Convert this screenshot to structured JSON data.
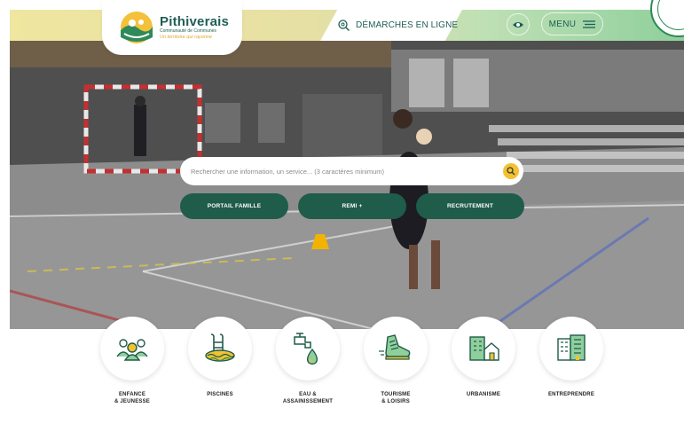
{
  "header": {
    "logo": {
      "name": "Pithiverais",
      "subtitle": "Communauté de Communes",
      "tagline": "Un territoire qui rayonne"
    },
    "demarches_label": "DÉMARCHES EN LIGNE",
    "menu_label": "MENU"
  },
  "search": {
    "placeholder": "Rechercher une information, un service... (3 caractères minimum)"
  },
  "quick_links": [
    {
      "label": "PORTAIL FAMILLE"
    },
    {
      "label": "REMI +"
    },
    {
      "label": "RECRUTEMENT"
    }
  ],
  "categories": [
    {
      "line1": "ENFANCE",
      "line2": "& JEUNESSE",
      "icon": "children-icon"
    },
    {
      "line1": "PISCINES",
      "line2": "",
      "icon": "pool-icon"
    },
    {
      "line1": "EAU &",
      "line2": "ASSAINISSEMENT",
      "icon": "water-tap-icon"
    },
    {
      "line1": "TOURISME",
      "line2": "& LOISIRS",
      "icon": "sneaker-icon"
    },
    {
      "line1": "URBANISME",
      "line2": "",
      "icon": "buildings-icon"
    },
    {
      "line1": "ENTREPRENDRE",
      "line2": "",
      "icon": "office-buildings-icon"
    }
  ],
  "colors": {
    "primary": "#1f5c4a",
    "accent": "#f2c230",
    "light_green": "#8fcf9c",
    "icon_green": "#2f8a5a"
  }
}
